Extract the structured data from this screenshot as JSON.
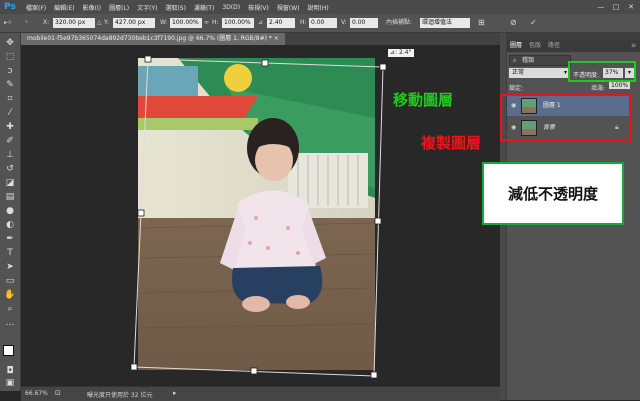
{
  "app": {
    "logo": "Ps"
  },
  "menu": [
    "檔案(F)",
    "編輯(E)",
    "影像(I)",
    "圖層(L)",
    "文字(Y)",
    "選取(S)",
    "濾鏡(T)",
    "3D(D)",
    "檢視(V)",
    "視窗(W)",
    "說明(H)"
  ],
  "window_controls": {
    "minimize": "—",
    "maximize": "□",
    "close": "✕"
  },
  "options": {
    "x_label": "X:",
    "x_value": "320.00 px",
    "y_label": "Y:",
    "y_value": "427.00 px",
    "w_label": "W:",
    "w_value": "100.00%",
    "h_label": "H:",
    "h_value": "100.00%",
    "angle_value": "2.40",
    "hskew_label": "H:",
    "hskew_value": "0.00",
    "vskew_label": "V:",
    "vskew_value": "0.00",
    "interp_label": "內插補點:",
    "interp_value": "環迴增值法"
  },
  "document": {
    "tab_title": "mobile01-f5e97b365074da892d730beb1c3f7190.jpg @ 66.7% (圖層 1, RGB/8#) *",
    "rotation_readout": "⊿: 2.4°"
  },
  "status": {
    "zoom": "66.67%",
    "info": "曝光度只使用於 32 位元"
  },
  "layers_panel": {
    "tabs": [
      "圖層",
      "色版",
      "路徑"
    ],
    "kind_label": "種類",
    "blend_mode": "正常",
    "opacity_label": "不透明度:",
    "opacity_value": "37%",
    "lock_label": "鎖定:",
    "fill_label": "填滿:",
    "fill_value": "100%",
    "layers": [
      {
        "name": "圖層 1"
      },
      {
        "name": "背景"
      }
    ]
  },
  "annotations": {
    "move_layer": "移動圖層",
    "duplicate_layer": "複製圖層",
    "reduce_opacity": "減低不透明度"
  },
  "colors": {
    "annotation_green": "#22c81e",
    "annotation_red": "#e8151b",
    "ps_blue": "#2fa3e6"
  }
}
